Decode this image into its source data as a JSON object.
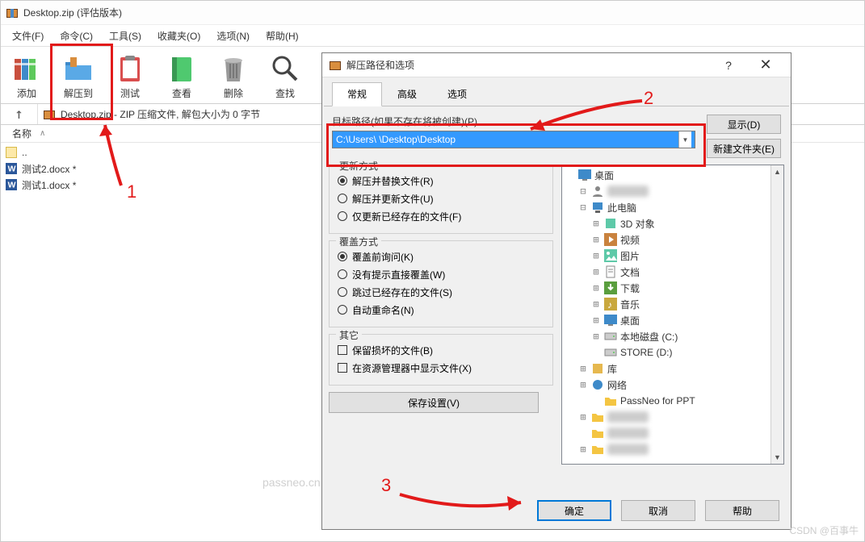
{
  "main": {
    "title": "Desktop.zip (评估版本)",
    "menus": [
      "文件(F)",
      "命令(C)",
      "工具(S)",
      "收藏夹(O)",
      "选项(N)",
      "帮助(H)"
    ],
    "toolbar": [
      {
        "label": "添加",
        "icon": "books"
      },
      {
        "label": "解压到",
        "icon": "folder-extract"
      },
      {
        "label": "测试",
        "icon": "clipboard"
      },
      {
        "label": "查看",
        "icon": "book"
      },
      {
        "label": "删除",
        "icon": "trash"
      },
      {
        "label": "查找",
        "icon": "magnify"
      }
    ],
    "pathbar": "Desktop.zip - ZIP 压缩文件, 解包大小为 0 字节",
    "col_name": "名称",
    "files": [
      "测试2.docx *",
      "测试1.docx *"
    ]
  },
  "dialog": {
    "title": "解压路径和选项",
    "tabs": [
      "常规",
      "高级",
      "选项"
    ],
    "path_label": "目标路径(如果不存在将被创建)(P)",
    "path_value": "C:\\Users\\          \\Desktop\\Desktop",
    "show_btn": "显示(D)",
    "newfolder_btn": "新建文件夹(E)",
    "update": {
      "title": "更新方式",
      "opts": [
        "解压并替换文件(R)",
        "解压并更新文件(U)",
        "仅更新已经存在的文件(F)"
      ],
      "selected": 0
    },
    "overwrite": {
      "title": "覆盖方式",
      "opts": [
        "覆盖前询问(K)",
        "没有提示直接覆盖(W)",
        "跳过已经存在的文件(S)",
        "自动重命名(N)"
      ],
      "selected": 0
    },
    "misc": {
      "title": "其它",
      "opts": [
        "保留损坏的文件(B)",
        "在资源管理器中显示文件(X)"
      ]
    },
    "save_btn": "保存设置(V)",
    "ok_btn": "确定",
    "cancel_btn": "取消",
    "help_btn": "帮助",
    "tree": [
      {
        "d": 0,
        "exp": "",
        "icon": "desktop",
        "label": "桌面"
      },
      {
        "d": 1,
        "exp": "-",
        "icon": "user",
        "label": "",
        "blur": true
      },
      {
        "d": 1,
        "exp": "-",
        "icon": "pc",
        "label": "此电脑"
      },
      {
        "d": 2,
        "exp": "+",
        "icon": "3d",
        "label": "3D 对象"
      },
      {
        "d": 2,
        "exp": "+",
        "icon": "video",
        "label": "视频"
      },
      {
        "d": 2,
        "exp": "+",
        "icon": "picture",
        "label": "图片"
      },
      {
        "d": 2,
        "exp": "+",
        "icon": "doc",
        "label": "文档"
      },
      {
        "d": 2,
        "exp": "+",
        "icon": "download",
        "label": "下载"
      },
      {
        "d": 2,
        "exp": "+",
        "icon": "music",
        "label": "音乐"
      },
      {
        "d": 2,
        "exp": "+",
        "icon": "desktop",
        "label": "桌面"
      },
      {
        "d": 2,
        "exp": "+",
        "icon": "disk",
        "label": "本地磁盘 (C:)"
      },
      {
        "d": 2,
        "exp": "",
        "icon": "disk",
        "label": "STORE (D:)"
      },
      {
        "d": 1,
        "exp": "+",
        "icon": "lib",
        "label": "库"
      },
      {
        "d": 1,
        "exp": "+",
        "icon": "net",
        "label": "网络"
      },
      {
        "d": 2,
        "exp": "",
        "icon": "folder",
        "label": "PassNeo for PPT"
      },
      {
        "d": 1,
        "exp": "+",
        "icon": "folder",
        "label": "",
        "blur": true
      },
      {
        "d": 1,
        "exp": "",
        "icon": "folder",
        "label": "",
        "blur": true
      },
      {
        "d": 1,
        "exp": "+",
        "icon": "folder",
        "label": "",
        "blur": true
      }
    ]
  },
  "annotations": {
    "n1": "1",
    "n2": "2",
    "n3": "3"
  },
  "watermark": "passneo.cn",
  "csdn": "CSDN @百事牛"
}
